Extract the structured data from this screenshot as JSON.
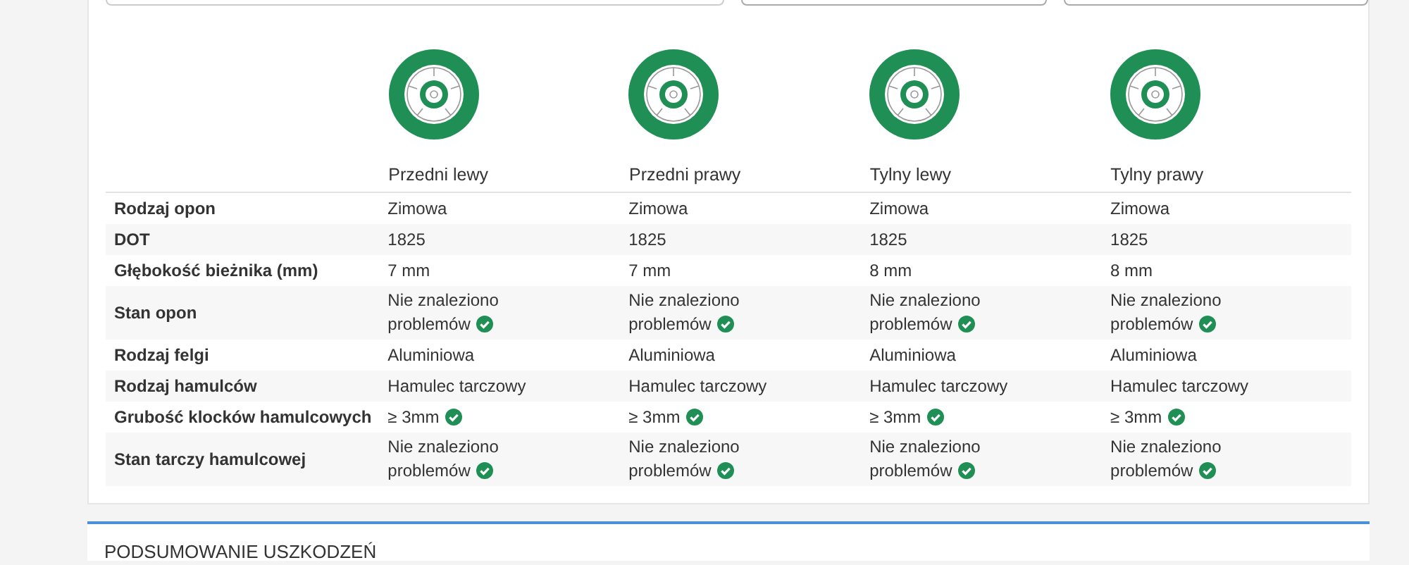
{
  "columns": [
    {
      "label": "Przedni lewy"
    },
    {
      "label": "Przedni prawy"
    },
    {
      "label": "Tylny lewy"
    },
    {
      "label": "Tylny prawy"
    }
  ],
  "rows": [
    {
      "label": "Rodzaj opon",
      "cells": [
        {
          "text": "Zimowa",
          "ok": false
        },
        {
          "text": "Zimowa",
          "ok": false
        },
        {
          "text": "Zimowa",
          "ok": false
        },
        {
          "text": "Zimowa",
          "ok": false
        }
      ]
    },
    {
      "label": "DOT",
      "cells": [
        {
          "text": "1825",
          "ok": false
        },
        {
          "text": "1825",
          "ok": false
        },
        {
          "text": "1825",
          "ok": false
        },
        {
          "text": "1825",
          "ok": false
        }
      ]
    },
    {
      "label": "Głębokość bieżnika (mm)",
      "cells": [
        {
          "text": "7 mm",
          "ok": false
        },
        {
          "text": "7 mm",
          "ok": false
        },
        {
          "text": "8 mm",
          "ok": false
        },
        {
          "text": "8 mm",
          "ok": false
        }
      ]
    },
    {
      "label": "Stan opon",
      "cells": [
        {
          "text": "Nie znaleziono problemów",
          "ok": true
        },
        {
          "text": "Nie znaleziono problemów",
          "ok": true
        },
        {
          "text": "Nie znaleziono problemów",
          "ok": true
        },
        {
          "text": "Nie znaleziono problemów",
          "ok": true
        }
      ]
    },
    {
      "label": "Rodzaj felgi",
      "cells": [
        {
          "text": "Aluminiowa",
          "ok": false
        },
        {
          "text": "Aluminiowa",
          "ok": false
        },
        {
          "text": "Aluminiowa",
          "ok": false
        },
        {
          "text": "Aluminiowa",
          "ok": false
        }
      ]
    },
    {
      "label": "Rodzaj hamulców",
      "cells": [
        {
          "text": "Hamulec tarczowy",
          "ok": false
        },
        {
          "text": "Hamulec tarczowy",
          "ok": false
        },
        {
          "text": "Hamulec tarczowy",
          "ok": false
        },
        {
          "text": "Hamulec tarczowy",
          "ok": false
        }
      ]
    },
    {
      "label": "Grubość klocków hamulcowych",
      "cells": [
        {
          "text": "≥ 3mm",
          "ok": true
        },
        {
          "text": "≥ 3mm",
          "ok": true
        },
        {
          "text": "≥ 3mm",
          "ok": true
        },
        {
          "text": "≥ 3mm",
          "ok": true
        }
      ]
    },
    {
      "label": "Stan tarczy hamulcowej",
      "cells": [
        {
          "text": "Nie znaleziono problemów",
          "ok": true
        },
        {
          "text": "Nie znaleziono problemów",
          "ok": true
        },
        {
          "text": "Nie znaleziono problemów",
          "ok": true
        },
        {
          "text": "Nie znaleziono problemów",
          "ok": true
        }
      ]
    }
  ],
  "next_section": {
    "title": "PODSUMOWANIE USZKODZEŃ"
  }
}
